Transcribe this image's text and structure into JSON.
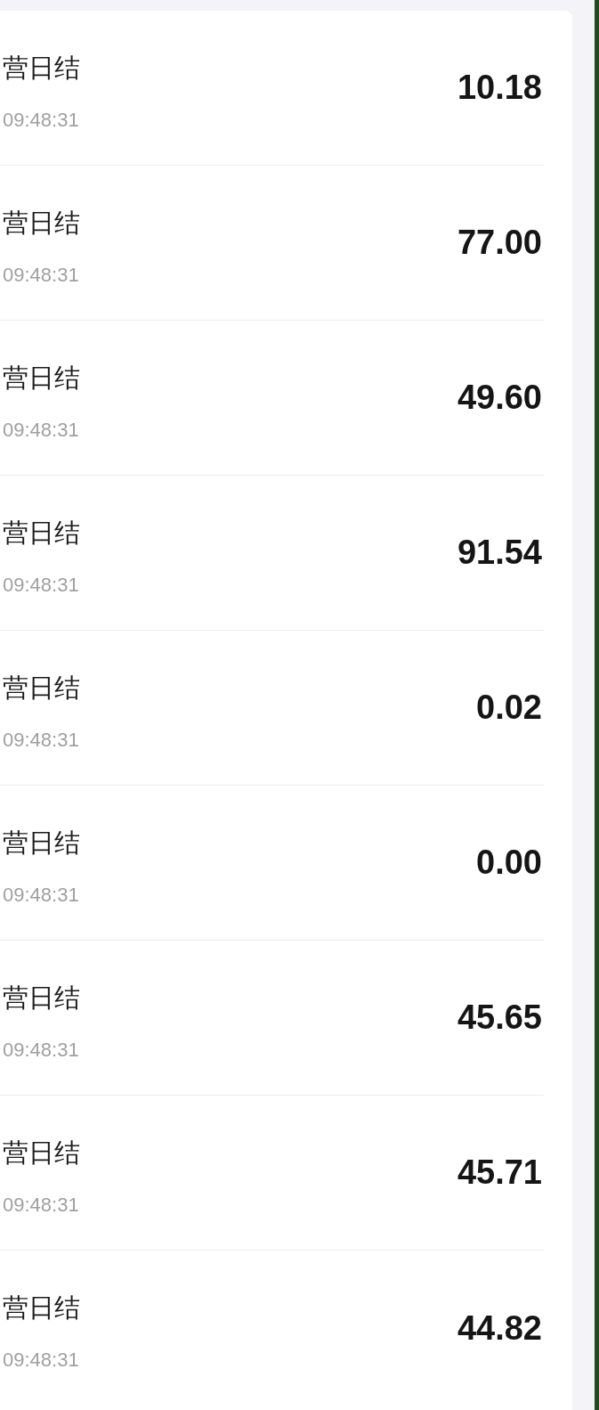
{
  "entries": [
    {
      "title": "营日结",
      "time": "09:48:31",
      "amount": "10.18"
    },
    {
      "title": "营日结",
      "time": "09:48:31",
      "amount": "77.00"
    },
    {
      "title": "营日结",
      "time": "09:48:31",
      "amount": "49.60"
    },
    {
      "title": "营日结",
      "time": "09:48:31",
      "amount": "91.54"
    },
    {
      "title": "营日结",
      "time": "09:48:31",
      "amount": "0.02"
    },
    {
      "title": "营日结",
      "time": "09:48:31",
      "amount": "0.00"
    },
    {
      "title": "营日结",
      "time": "09:48:31",
      "amount": "45.65"
    },
    {
      "title": "营日结",
      "time": "09:48:31",
      "amount": "45.71"
    },
    {
      "title": "营日结",
      "time": "09:48:31",
      "amount": "44.82"
    }
  ]
}
